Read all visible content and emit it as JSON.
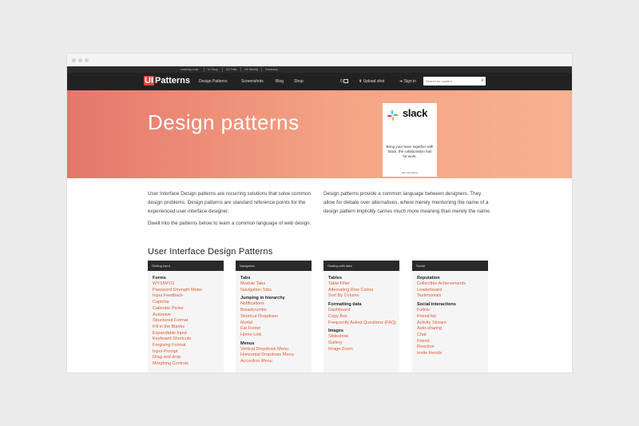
{
  "topstrip": {
    "links": [
      "Learning Loop",
      "UI Shop",
      "UX Tribe",
      "UX Weekly",
      "Feedshop"
    ]
  },
  "nav": {
    "logo_mark": "UI",
    "logo_text": "Patterns",
    "links": [
      "Design Patterns",
      "Screenshots",
      "Blog",
      "Shop"
    ],
    "counter": "0",
    "upload": "Upload shot",
    "signin": "Sign in",
    "search_placeholder": "Search for content..."
  },
  "hero": {
    "title": "Design patterns",
    "ad": {
      "brand": "slack",
      "copy": "Bring your team together with Slack, the collaboration hub for work.",
      "via": "ads via Carbon"
    }
  },
  "intro": {
    "left_p1": "User Interface Design patterns are recurring solutions that solve common design problems. Design patterns are standard reference points for the experienced user interface designer.",
    "left_p2": "Dwell into the patterns below to learn a common language of web design.",
    "right_p1": "Design patterns provide a common language between designers. They allow for debate over alternatives, where merely mentioning the name of a design pattern implicitly carries much more meaning than merely the name."
  },
  "section_title": "User Interface Design Patterns",
  "columns": [
    {
      "header": "Getting input",
      "groups": [
        {
          "title": "Forms",
          "items": [
            "WYSIWYG",
            "Password Strength Meter",
            "Input Feedback",
            "Captcha",
            "Calendar Picker",
            "Autosave",
            "Structured Format",
            "Fill in the Blanks",
            "Expandable Input",
            "Keyboard Shortcuts",
            "Forgiving Format",
            "Input Prompt",
            "Drag and drop",
            "Morphing Controls"
          ]
        }
      ]
    },
    {
      "header": "Navigation",
      "groups": [
        {
          "title": "Tabs",
          "items": [
            "Module Tabs",
            "Navigation Tabs"
          ]
        },
        {
          "title": "Jumping in hierarchy",
          "items": [
            "Notifications",
            "Breadcrumbs",
            "Shortcut Dropdown",
            "Modal",
            "Fat Footer",
            "Home Link"
          ]
        },
        {
          "title": "Menus",
          "items": [
            "Vertical Dropdown Menu",
            "Horizontal Dropdown Menu",
            "Accordion Menu"
          ]
        }
      ]
    },
    {
      "header": "Dealing with data",
      "groups": [
        {
          "title": "Tables",
          "items": [
            "Table Filter",
            "Alternating Row Colors",
            "Sort By Column"
          ]
        },
        {
          "title": "Formatting data",
          "items": [
            "Dashboard",
            "Copy Box",
            "Frequently Asked Questions (FAQ)"
          ]
        },
        {
          "title": "Images",
          "items": [
            "Slideshow",
            "Gallery",
            "Image Zoom"
          ]
        }
      ]
    },
    {
      "header": "Social",
      "groups": [
        {
          "title": "Reputation",
          "items": [
            "Collectible Achievements",
            "Leaderboard",
            "Testimonials"
          ]
        },
        {
          "title": "Social interactions",
          "items": [
            "Follow",
            "Friend list",
            "Activity Stream",
            "Auto-sharing",
            "Chat",
            "Friend",
            "Reaction",
            "Invite friends"
          ]
        }
      ]
    }
  ]
}
